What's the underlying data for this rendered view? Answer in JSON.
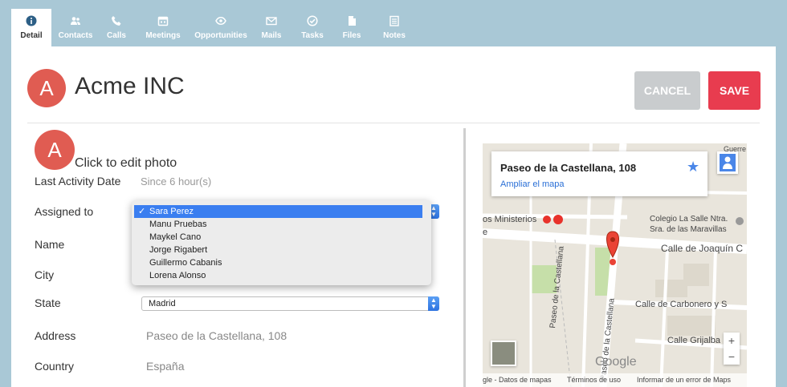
{
  "tabs": [
    {
      "label": "Detail",
      "icon": "info-icon"
    },
    {
      "label": "Contacts",
      "icon": "contacts-icon"
    },
    {
      "label": "Calls",
      "icon": "phone-icon"
    },
    {
      "label": "Meetings",
      "icon": "calendar-icon"
    },
    {
      "label": "Opportunities",
      "icon": "eye-icon"
    },
    {
      "label": "Mails",
      "icon": "mail-icon"
    },
    {
      "label": "Tasks",
      "icon": "check-icon"
    },
    {
      "label": "Files",
      "icon": "file-icon"
    },
    {
      "label": "Notes",
      "icon": "notes-icon"
    }
  ],
  "header": {
    "avatar_letter": "A",
    "title": "Acme INC",
    "cancel_label": "CANCEL",
    "save_label": "SAVE"
  },
  "photo": {
    "avatar_letter": "A",
    "edit_label": "Click to edit photo"
  },
  "form": {
    "last_activity_label": "Last Activity Date",
    "last_activity_value": "Since 6 hour(s)",
    "assigned_label": "Assigned to",
    "name_label": "Name",
    "city_label": "City",
    "state_label": "State",
    "state_value": "Madrid",
    "address_label": "Address",
    "address_value": "Paseo de la Castellana, 108",
    "country_label": "Country",
    "country_value": "España"
  },
  "assigned_options": [
    {
      "label": "Sara Perez",
      "selected": true
    },
    {
      "label": "Manu Pruebas",
      "selected": false
    },
    {
      "label": "Maykel Cano",
      "selected": false
    },
    {
      "label": "Jorge Rigabert",
      "selected": false
    },
    {
      "label": "Guillermo Cabanis",
      "selected": false
    },
    {
      "label": "Lorena Alonso",
      "selected": false
    }
  ],
  "map": {
    "info_title": "Paseo de la Castellana, 108",
    "info_link": "Ampliar el mapa",
    "labels": {
      "guerrero": "Guerre",
      "ministerios": "os Ministerios",
      "colegio": "Colegio La Salle Ntra.",
      "colegio2": "Sra. de las Maravillas",
      "joaquin": "Calle de Joaquín C",
      "carbonero": "Calle de Carbonero y S",
      "grijalba": "Calle Grijalba",
      "castellana1": "Paseo de la Castellana",
      "castellana2": "Paseo de la Castellana",
      "e_edge": "e"
    },
    "logo": "Google",
    "zoom_in": "+",
    "zoom_out": "−",
    "attribution": {
      "data": "gle - Datos de mapas",
      "terms": "Términos de uso",
      "report": "Informar de un error de Maps"
    }
  },
  "colors": {
    "tabbar": "#a9c8d6",
    "avatar": "#e05c52",
    "save": "#e83c4f",
    "cancel": "#c9ccce",
    "select_highlight": "#3a7ef0"
  }
}
